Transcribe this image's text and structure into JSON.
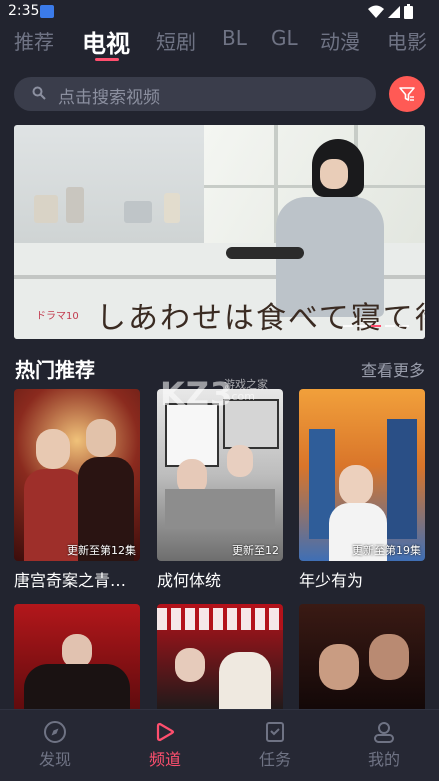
{
  "status_bar": {
    "time": "2:35"
  },
  "tabs": [
    {
      "label": "推荐",
      "active": false
    },
    {
      "label": "电视",
      "active": true
    },
    {
      "label": "短剧",
      "active": false
    },
    {
      "label": "BL",
      "active": false
    },
    {
      "label": "GL",
      "active": false
    },
    {
      "label": "动漫",
      "active": false
    },
    {
      "label": "电影",
      "active": false
    }
  ],
  "search": {
    "placeholder": "点击搜索视频",
    "icon": "search-icon",
    "filter_icon": "filter-icon"
  },
  "banner": {
    "title": "しあわせは食べて寝て待て",
    "tag": "ドラマ10"
  },
  "hot": {
    "title": "热门推荐",
    "more": "查看更多",
    "items": [
      {
        "title": "唐宫奇案之青…",
        "episode": "更新至第12集"
      },
      {
        "title": "成何体统",
        "episode": "更新至12"
      },
      {
        "title": "年少有为",
        "episode": "更新至第19集"
      }
    ]
  },
  "watermark": {
    "logo": "KZ3",
    "site": "游戏之家",
    "domain": ".com"
  },
  "nav": [
    {
      "label": "发现",
      "icon": "compass-icon",
      "active": false
    },
    {
      "label": "频道",
      "icon": "play-icon",
      "active": true
    },
    {
      "label": "任务",
      "icon": "task-icon",
      "active": false
    },
    {
      "label": "我的",
      "icon": "user-icon",
      "active": false
    }
  ],
  "colors": {
    "accent": "#ff4f6e",
    "background": "#22242f",
    "filter_button": "#ff5a55"
  }
}
